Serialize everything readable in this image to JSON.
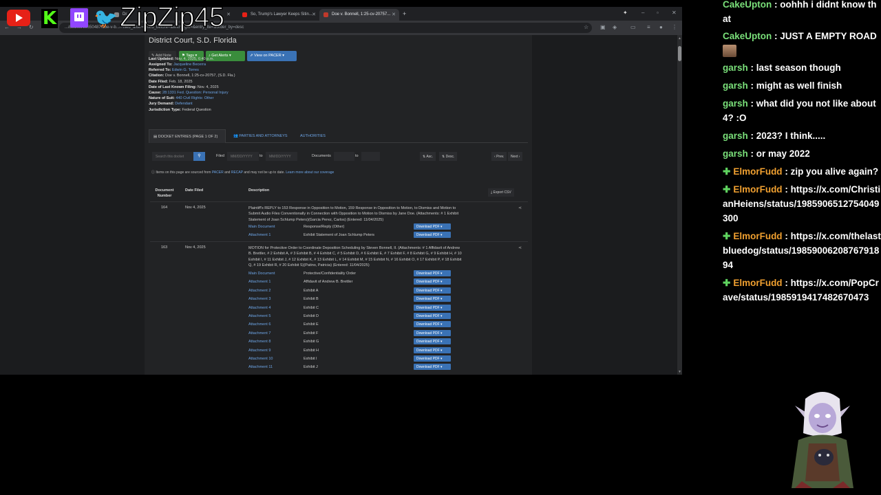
{
  "stream": {
    "handle": "ZipZip45",
    "social_icons": [
      "youtube-icon",
      "kick-icon",
      "twitch-icon",
      "twitter-icon"
    ]
  },
  "browser": {
    "tabs": [
      {
        "label": "Dr..."
      },
      {
        "label": "So, Trump's Lawyer Keeps Sitin..."
      },
      {
        "label": "Doe v. Bonnell, 1:25-cv-20757..."
      }
    ],
    "url": ".../docket/69650487/doe-v-b.../?filed_after=&filed_before=&entry_gte=&entry_lte=&order_by=desc"
  },
  "page": {
    "court": "District Court, S.D. Florida",
    "buttons": {
      "add_note": "Add Note",
      "tags": "Tags",
      "get_alerts": "Get Alerts",
      "view_pacer": "View on PACER"
    },
    "meta": [
      {
        "label": "Last Updated:",
        "value": "Nov. 4, 2025, 6:40 p.m.",
        "link": false
      },
      {
        "label": "Assigned To:",
        "value": "Jacqueline Becerra",
        "link": true
      },
      {
        "label": "Referred To:",
        "value": "Edwin G. Torres",
        "link": true
      },
      {
        "label": "Citation:",
        "value": "Doe v. Bonnell, 1:25-cv-20757, (S.D. Fla.)",
        "link": false
      },
      {
        "label": "Date Filed:",
        "value": "Feb. 18, 2025",
        "link": false
      },
      {
        "label": "Date of Last Known Filing:",
        "value": "Nov. 4, 2025",
        "link": false
      },
      {
        "label": "Cause:",
        "value": "28:1331 Fed. Question: Personal Injury",
        "link": true
      },
      {
        "label": "Nature of Suit:",
        "value": "440 Civil Rights: Other",
        "link": true
      },
      {
        "label": "Jury Demand:",
        "value": "Defendant",
        "link": true
      },
      {
        "label": "Jurisdiction Type:",
        "value": "Federal Question",
        "link": false
      }
    ],
    "tabs": {
      "docket": "DOCKET ENTRIES (PAGE 1 OF 2)",
      "parties": "PARTIES AND ATTORNEYS",
      "authorities": "AUTHORITIES"
    },
    "filters": {
      "search_placeholder": "Search this docket",
      "filed_label": "Filed",
      "date_placeholder": "MM/DD/YYYY",
      "to_label": "to",
      "documents_label": "Documents",
      "asc": "Asc.",
      "desc": "Desc.",
      "prev": "Prev.",
      "next": "Next"
    },
    "notice": {
      "prefix": "Items on this page are sourced from",
      "pacer": "PACER",
      "and": "and",
      "recap": "RECAP",
      "suffix": "and may not be up to date.",
      "learn": "Learn more about our coverage"
    },
    "table_headers": {
      "doc_number": "Document Number",
      "date_filed": "Date Filed",
      "description": "Description",
      "export": "Export CSV"
    },
    "download_label": "Download PDF",
    "entries": [
      {
        "number": "164",
        "date": "Nov 4, 2025",
        "description": "Plaintiff's REPLY to 153 Response in Opposition to Motion, 159 Response in Opposition to Motion, to Dismiss and Motion to Submit Audio Files Conventionally in Connection with Opposition to Motion to Dismiss by Jane Doe. (Attachments: # 1 Exhibit Statement of Joan Schlump Peters)(Garcia Perez, Carlos) (Entered: 11/04/2025)",
        "docs": [
          {
            "link": "Main Document",
            "text": "Response/Reply (Other)"
          },
          {
            "link": "Attachment 1",
            "text": "Exhibit Statement of Joan Schlump Peters"
          }
        ]
      },
      {
        "number": "163",
        "date": "Nov 4, 2025",
        "description": "MOTION for Protective Order to Coordinate Deposition Scheduling by Steven Bonnell, II. (Attachments: # 1 Affidavit of Andrew B. Brettler, # 2 Exhibit A, # 3 Exhibit B, # 4 Exhibit C, # 5 Exhibit D, # 6 Exhibit E, # 7 Exhibit F, # 8 Exhibit G, # 9 Exhibit H, # 10 Exhibit I, # 11 Exhibit J, # 12 Exhibit K, # 13 Exhibit L, # 14 Exhibit M, # 15 Exhibit N, # 16 Exhibit O, # 17 Exhibit P, # 18 Exhibit Q, # 19 Exhibit R, # 20 Exhibit S)(Patino, Patricia) (Entered: 11/04/2025)",
        "docs": [
          {
            "link": "Main Document",
            "text": "Protective/Confidentiality Order"
          },
          {
            "link": "Attachment 1",
            "text": "Affidavit of Andrew B. Brettler"
          },
          {
            "link": "Attachment 2",
            "text": "Exhibit A"
          },
          {
            "link": "Attachment 3",
            "text": "Exhibit B"
          },
          {
            "link": "Attachment 4",
            "text": "Exhibit C"
          },
          {
            "link": "Attachment 5",
            "text": "Exhibit D"
          },
          {
            "link": "Attachment 6",
            "text": "Exhibit E"
          },
          {
            "link": "Attachment 7",
            "text": "Exhibit F"
          },
          {
            "link": "Attachment 8",
            "text": "Exhibit G"
          },
          {
            "link": "Attachment 9",
            "text": "Exhibit H"
          },
          {
            "link": "Attachment 10",
            "text": "Exhibit I"
          },
          {
            "link": "Attachment 11",
            "text": "Exhibit J"
          }
        ]
      }
    ]
  },
  "chat": [
    {
      "user": "CakeUpton",
      "text": "oohhh i didnt know that",
      "style": "cake",
      "badge": false,
      "emote": false
    },
    {
      "user": "CakeUpton",
      "text": "JUST A EMPTY ROAD",
      "style": "cake",
      "badge": false,
      "emote": true
    },
    {
      "user": "garsh",
      "text": "last season though",
      "style": "garsh",
      "badge": false,
      "emote": false
    },
    {
      "user": "garsh",
      "text": "might as well finish",
      "style": "garsh",
      "badge": false,
      "emote": false
    },
    {
      "user": "garsh",
      "text": "what did you not like about 4? :O",
      "style": "garsh",
      "badge": false,
      "emote": false
    },
    {
      "user": "garsh",
      "text": "2023? I think.....",
      "style": "garsh",
      "badge": false,
      "emote": false
    },
    {
      "user": "garsh",
      "text": "or may 2022",
      "style": "garsh",
      "badge": false,
      "emote": false
    },
    {
      "user": "ElmorFudd",
      "text": "zip you alive again?",
      "style": "elmor",
      "badge": true,
      "emote": false
    },
    {
      "user": "ElmorFudd",
      "text": "https://x.com/ChristianHeiens/status/1985906512754049300",
      "style": "elmor",
      "badge": true,
      "emote": false
    },
    {
      "user": "ElmorFudd",
      "text": "https://x.com/thelastbluedog/status/1985900620876791894",
      "style": "elmor",
      "badge": true,
      "emote": false
    },
    {
      "user": "ElmorFudd",
      "text": "https://x.com/PopCrave/status/1985919417482670473",
      "style": "elmor",
      "badge": true,
      "emote": false
    }
  ]
}
